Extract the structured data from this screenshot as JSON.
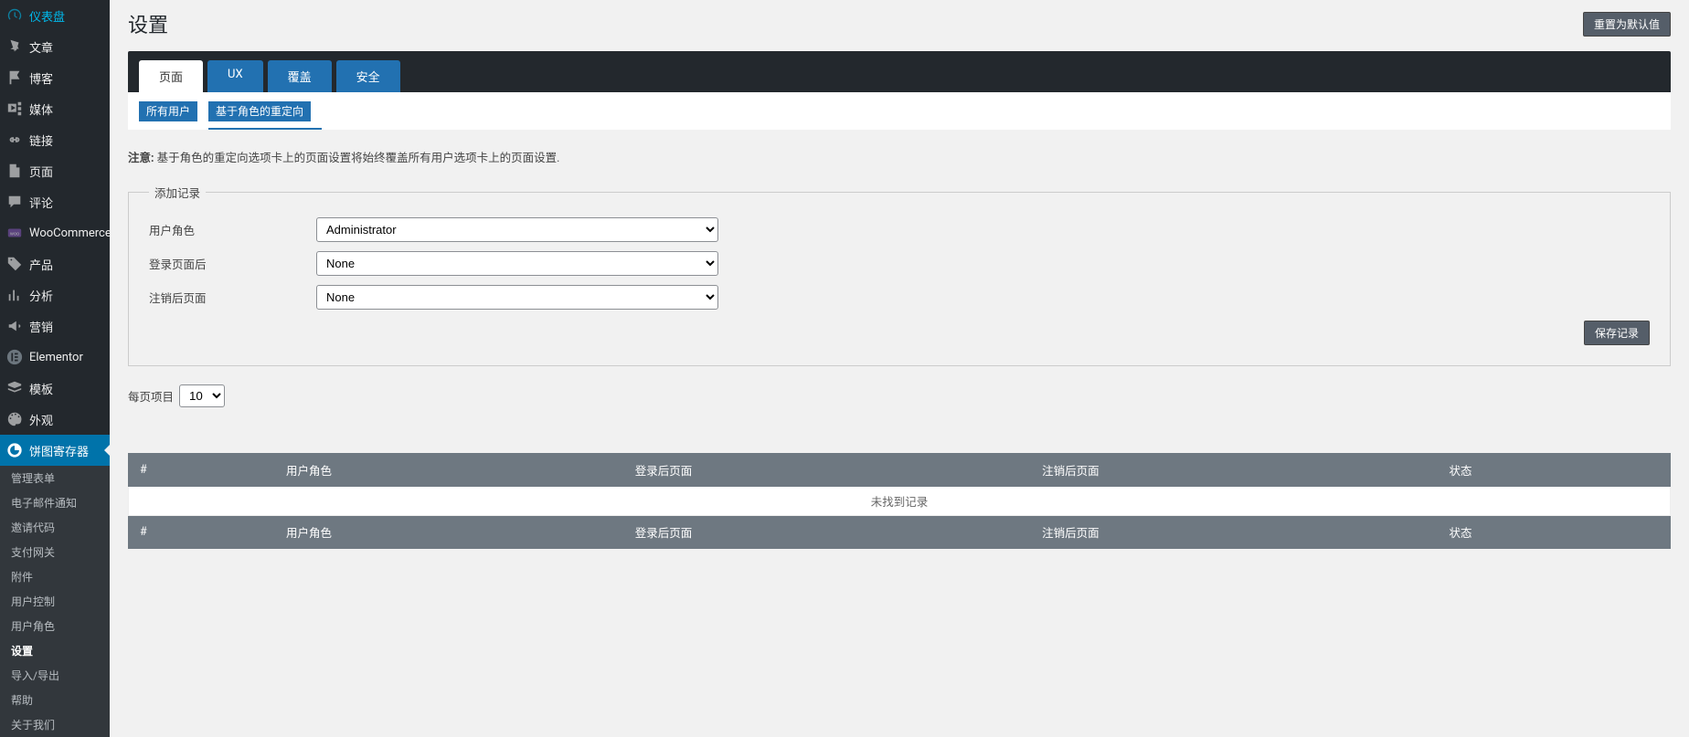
{
  "sidebar": {
    "items": [
      {
        "label": "仪表盘",
        "icon": "dashboard-icon"
      },
      {
        "label": "文章",
        "icon": "pin-icon"
      },
      {
        "label": "博客",
        "icon": "flag-icon"
      },
      {
        "label": "媒体",
        "icon": "media-icon"
      },
      {
        "label": "链接",
        "icon": "link-icon"
      },
      {
        "label": "页面",
        "icon": "page-icon"
      },
      {
        "label": "评论",
        "icon": "comment-icon"
      },
      {
        "label": "WooCommerce",
        "icon": "woo-icon"
      },
      {
        "label": "产品",
        "icon": "product-icon"
      },
      {
        "label": "分析",
        "icon": "analytics-icon"
      },
      {
        "label": "营销",
        "icon": "marketing-icon"
      },
      {
        "label": "Elementor",
        "icon": "elementor-icon"
      },
      {
        "label": "模板",
        "icon": "template-icon"
      },
      {
        "label": "外观",
        "icon": "appearance-icon"
      },
      {
        "label": "饼图寄存器",
        "icon": "pie-icon",
        "active": true
      }
    ],
    "submenu": [
      {
        "label": "管理表单"
      },
      {
        "label": "电子邮件通知"
      },
      {
        "label": "邀请代码"
      },
      {
        "label": "支付网关"
      },
      {
        "label": "附件"
      },
      {
        "label": "用户控制"
      },
      {
        "label": "用户角色"
      },
      {
        "label": "设置",
        "active": true
      },
      {
        "label": "导入/导出"
      },
      {
        "label": "帮助"
      },
      {
        "label": "关于我们"
      }
    ]
  },
  "header": {
    "title": "设置",
    "reset_btn": "重置为默认值"
  },
  "tabs": [
    {
      "label": "页面",
      "active": true
    },
    {
      "label": "UX"
    },
    {
      "label": "覆盖"
    },
    {
      "label": "安全"
    }
  ],
  "subtabs": [
    {
      "label": "所有用户"
    },
    {
      "label": "基于角色的重定向",
      "active": true
    }
  ],
  "notice": {
    "bold": "注意:",
    "text": " 基于角色的重定向选项卡上的页面设置将始终覆盖所有用户选项卡上的页面设置."
  },
  "form": {
    "legend": "添加记录",
    "rows": [
      {
        "label": "用户角色",
        "value": "Administrator"
      },
      {
        "label": "登录页面后",
        "value": "None"
      },
      {
        "label": "注销后页面",
        "value": "None"
      }
    ],
    "save_btn": "保存记录"
  },
  "items_per": {
    "label": "每页项目",
    "value": "10"
  },
  "table": {
    "headers": [
      "#",
      "用户角色",
      "登录后页面",
      "注销后页面",
      "状态"
    ],
    "empty": "未找到记录"
  }
}
